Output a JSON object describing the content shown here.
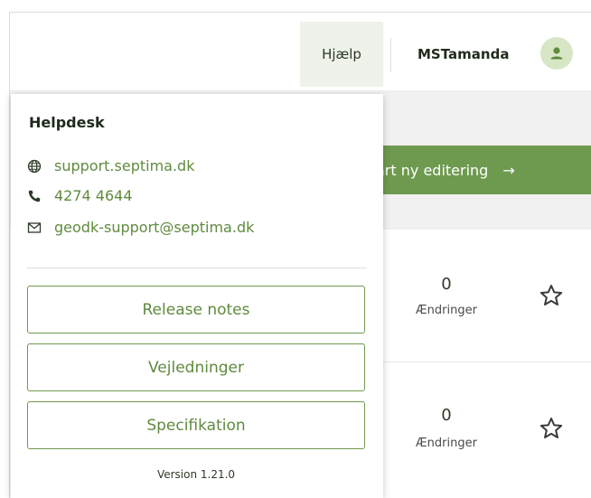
{
  "header": {
    "help_label": "Hjælp",
    "username": "MSTamanda",
    "avatar_icon": "user-icon"
  },
  "main": {
    "start_button_label": "Start ny editering",
    "start_button_visible": "art ny editering",
    "rows": [
      {
        "count": "0",
        "count_label": "Ændringer"
      },
      {
        "count": "0",
        "count_label": "Ændringer"
      }
    ]
  },
  "helpdesk": {
    "title": "Helpdesk",
    "website": "support.septima.dk",
    "phone": "4274 4644",
    "email": "geodk-support@septima.dk",
    "buttons": [
      {
        "label": "Release notes"
      },
      {
        "label": "Vejledninger"
      },
      {
        "label": "Specifikation"
      }
    ],
    "version": "Version 1.21.0"
  },
  "colors": {
    "accent": "#6e9a4f",
    "link": "#5f8a3e",
    "avatar_bg": "#d7e6c5",
    "help_active_bg": "#eef2ea"
  }
}
